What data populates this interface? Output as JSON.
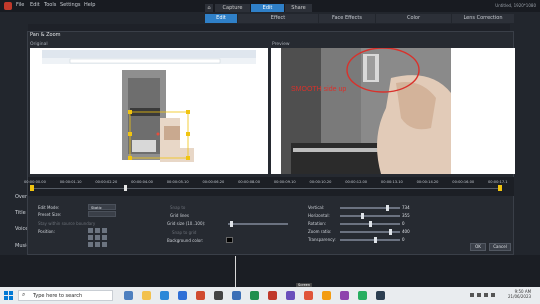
{
  "menu": {
    "items": [
      "File",
      "Edit",
      "Tools",
      "Settings",
      "Help"
    ],
    "window_title": "Untitled, 1920*1080"
  },
  "workflow_tabs": [
    "Capture",
    "Edit",
    "Share"
  ],
  "options_tabs": [
    "Edit",
    "Effect",
    "Face Effects",
    "Color",
    "Lens Correction"
  ],
  "side_labels": [
    "Over",
    "Title",
    "Voice",
    "Music"
  ],
  "dialog": {
    "title": "Pan & Zoom",
    "original_label": "Original",
    "preview_label": "Preview",
    "preview_caption": "SMOOTH side up"
  },
  "timeline": {
    "ticks": [
      "00:00:00.00",
      "00:00:01.10",
      "00:00:02.20",
      "00:00:04.00",
      "00:00:05.10",
      "00:00:06.20",
      "00:00:08.00",
      "00:00:09.10",
      "00:00:10.20",
      "00:00:12.00",
      "00:00:13.10",
      "00:00:14.20",
      "00:00:16.00",
      "00:00:17.1"
    ]
  },
  "controls": {
    "edit_mode_label": "Edit Mode:",
    "edit_mode_value": "Static",
    "preset_label": "Preset Size:",
    "position_label": "Position:",
    "keep_ratio_label": "Stay within source boundary",
    "snap_label": "Snap to",
    "grid_lines_label": "Grid lines",
    "grid_size_label": "Grid size (10..100):",
    "snap_grid_label": "Snap to grid",
    "bg_color_label": "Background color:",
    "vertical_label": "Vertical:",
    "vertical_value": "734",
    "horizontal_label": "Horizontal:",
    "horizontal_value": "355",
    "rotation_label": "Rotation:",
    "rotation_value": "0",
    "zoom_label": "Zoom ratio:",
    "zoom_value": "400",
    "transparency_label": "Transparency:",
    "transparency_value": "0",
    "ok_label": "OK",
    "cancel_label": "Cancel"
  },
  "taskbar": {
    "search_placeholder": "Type here to search",
    "time": "9:50 AM",
    "date": "21/06/2023",
    "tooltip": "Screen"
  },
  "colors": {
    "accent": "#2f80c8",
    "circle": "#d9312b",
    "caption": "#d9312b"
  }
}
